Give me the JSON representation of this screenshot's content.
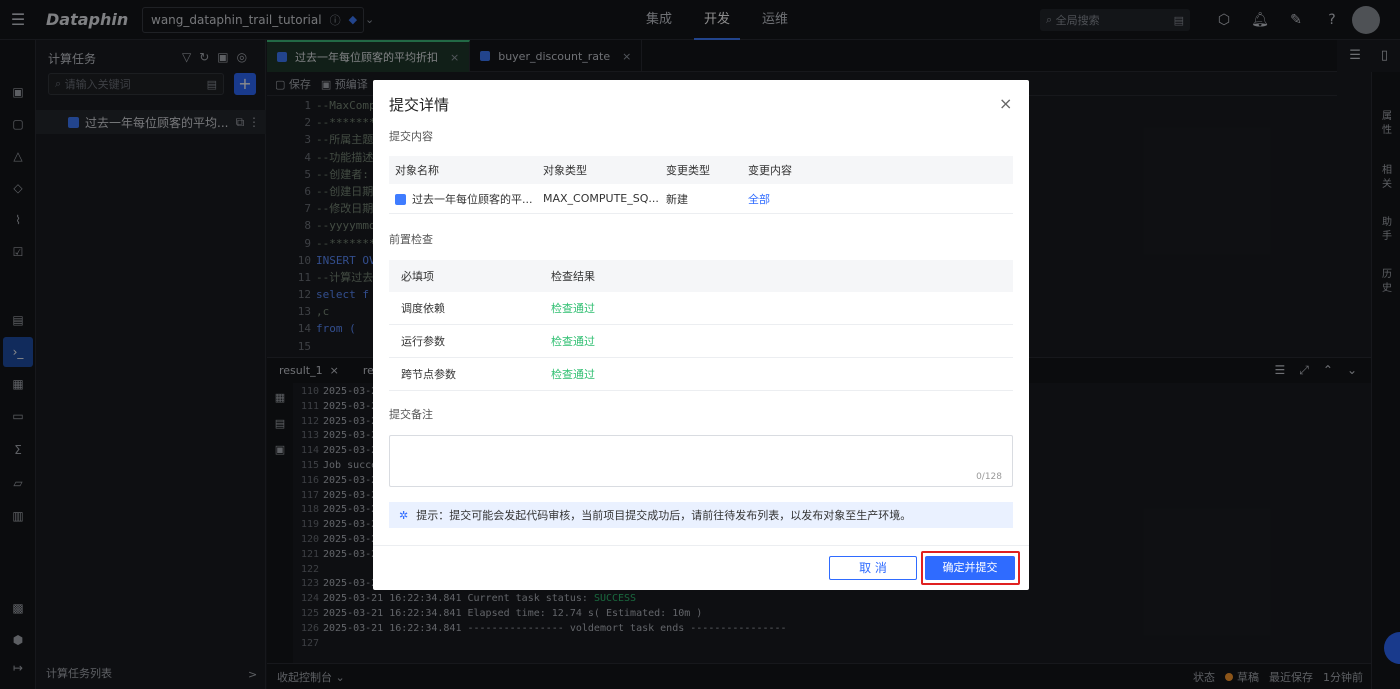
{
  "topbar": {
    "logo": "Dataphin",
    "project": "wang_dataphin_trail_tutorial",
    "nav": [
      "集成",
      "开发",
      "运维"
    ],
    "active_nav": "开发",
    "search_placeholder": "全局搜索"
  },
  "task_panel": {
    "title": "计算任务",
    "search_placeholder": "请输入关键词",
    "add_label": "+",
    "item_label": "过去一年每位顾客的平均...",
    "footer_label": "计算任务列表",
    "footer_arrow": ">"
  },
  "editor_tabs": [
    {
      "label": "过去一年每位顾客的平均折扣",
      "active": true
    },
    {
      "label": "buyer_discount_rate",
      "active": false
    }
  ],
  "toolbar": {
    "save": "保存",
    "precompile": "预编译"
  },
  "editor": {
    "line_numbers": [
      "1",
      "2",
      "3",
      "4",
      "5",
      "6",
      "7",
      "8",
      "9",
      "10",
      "11",
      "12",
      "13",
      "14",
      "15"
    ],
    "lines": [
      "--MaxComp",
      "--*******",
      "--所属主题",
      "--功能描述",
      "--创建者:",
      "--创建日期",
      "--修改日期",
      "--yyyymmd",
      "--*******",
      "INSERT OV",
      "--计算过去",
      "select  f",
      "       ,c",
      "from    (",
      ""
    ]
  },
  "right_rail": [
    "属性",
    "相关",
    "助手",
    "历史"
  ],
  "result": {
    "tabs": [
      "result_1",
      "re"
    ],
    "logs": [
      {
        "n": "110",
        "t": "2025-03-2"
      },
      {
        "n": "111",
        "t": "2025-03-2"
      },
      {
        "n": "112",
        "t": "2025-03-2"
      },
      {
        "n": "113",
        "t": "2025-03-2"
      },
      {
        "n": "114",
        "t": "2025-03-2"
      },
      {
        "n": "115",
        "t": "Job succe"
      },
      {
        "n": "116",
        "t": "2025-03-2"
      },
      {
        "n": "117",
        "t": "2025-03-2"
      },
      {
        "n": "118",
        "t": "2025-03-2"
      },
      {
        "n": "119",
        "t": "2025-03-2"
      },
      {
        "n": "120",
        "t": "2025-03-2"
      },
      {
        "n": "121",
        "t": "2025-03-2"
      },
      {
        "n": "122",
        "t": ""
      },
      {
        "n": "123",
        "t": "2025-03-2"
      },
      {
        "n": "124",
        "t": "2025-03-21 16:22:34.841 Current task status: ",
        "ok": "SUCCESS"
      },
      {
        "n": "125",
        "t": "2025-03-21 16:22:34.841 Elapsed time: 12.74 s( Estimated: 10m )"
      },
      {
        "n": "126",
        "t": "2025-03-21 16:22:34.841 ---------------- voldemort task ends ----------------"
      },
      {
        "n": "127",
        "t": ""
      }
    ]
  },
  "bottombar": {
    "collapse": "收起控制台",
    "status_label": "状态",
    "status_value": "草稿",
    "saved_label": "最近保存",
    "saved_value": "1分钟前"
  },
  "modal": {
    "title": "提交详情",
    "close": "×",
    "content_label": "提交内容",
    "content_headers": [
      "对象名称",
      "对象类型",
      "变更类型",
      "变更内容"
    ],
    "content_row": {
      "name": "过去一年每位顾客的平...",
      "type": "MAX_COMPUTE_SQ...",
      "change_type": "新建",
      "change_content": "全部"
    },
    "precheck_label": "前置检查",
    "precheck_headers": [
      "必填项",
      "检查结果"
    ],
    "precheck_rows": [
      {
        "item": "调度依赖",
        "result": "检查通过"
      },
      {
        "item": "运行参数",
        "result": "检查通过"
      },
      {
        "item": "跨节点参数",
        "result": "检查通过"
      }
    ],
    "remark_label": "提交备注",
    "remark_counter": "0/128",
    "hint": "提示：提交可能会发起代码审核，当前项目提交成功后，请前往待发布列表，以发布对象至生产环境。",
    "cancel": "取 消",
    "confirm": "确定并提交"
  }
}
